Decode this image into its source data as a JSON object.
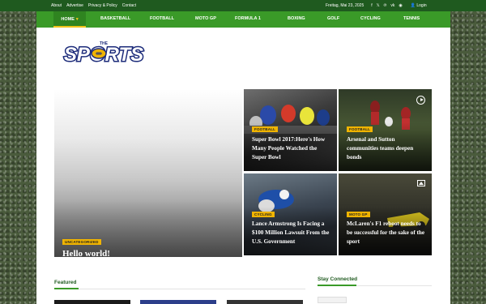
{
  "topbar": {
    "links": [
      "About",
      "Advertise",
      "Privacy & Policy",
      "Contact"
    ],
    "date": "Freitag, Mai 23, 2025",
    "login": "Login",
    "social_icons": [
      "facebook-icon",
      "x-icon",
      "pinterest-icon",
      "vk-icon",
      "rss-icon"
    ]
  },
  "nav": {
    "home": "HOME",
    "items": [
      "BASKETBALL",
      "FOOTBALL",
      "MOTO GP",
      "FORMULA 1",
      "BOXING",
      "GOLF",
      "CYCLING",
      "TENNIS"
    ]
  },
  "logo": {
    "text": "SPORTS",
    "tagline": "THE"
  },
  "hero": {
    "category": "UNCATEGORIZED",
    "title": "Hello world!"
  },
  "cards": [
    {
      "category": "FOOTBALL",
      "title": "Super Bowl 2017:Here's How Many People Watched the Super Bowl",
      "icon": ""
    },
    {
      "category": "FOOTBALL",
      "title": "Arsenal and Sutton communities teams deepen bonds",
      "icon": "play-icon"
    },
    {
      "category": "CYCLING",
      "title": "Lance Armstrong Is Facing a $100 Million Lawsuit From the U.S. Government",
      "icon": ""
    },
    {
      "category": "MOTO GP",
      "title": "McLaren's F1 reboot needs to be successful for the sake of the sport",
      "icon": "image-icon"
    }
  ],
  "sections": {
    "featured": "Featured",
    "stay_connected": "Stay Connected"
  },
  "colors": {
    "brand_green": "#3a9a28",
    "dark_green": "#1f5a1f",
    "badge_yellow": "#f0b400",
    "logo_navy": "#1c2b7a"
  }
}
